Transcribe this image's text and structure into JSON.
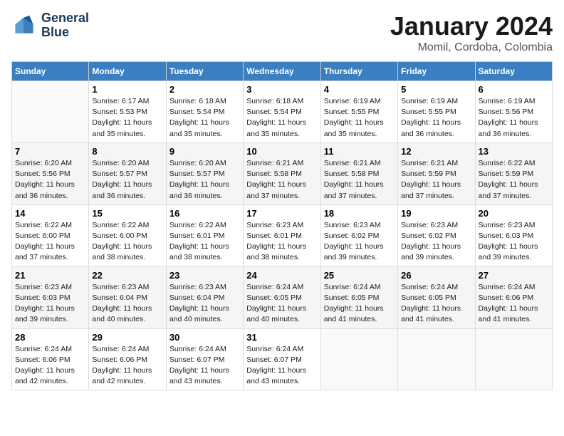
{
  "logo": {
    "line1": "General",
    "line2": "Blue"
  },
  "title": "January 2024",
  "subtitle": "Momil, Cordoba, Colombia",
  "days_header": [
    "Sunday",
    "Monday",
    "Tuesday",
    "Wednesday",
    "Thursday",
    "Friday",
    "Saturday"
  ],
  "weeks": [
    [
      {
        "num": "",
        "info": ""
      },
      {
        "num": "1",
        "info": "Sunrise: 6:17 AM\nSunset: 5:53 PM\nDaylight: 11 hours\nand 35 minutes."
      },
      {
        "num": "2",
        "info": "Sunrise: 6:18 AM\nSunset: 5:54 PM\nDaylight: 11 hours\nand 35 minutes."
      },
      {
        "num": "3",
        "info": "Sunrise: 6:18 AM\nSunset: 5:54 PM\nDaylight: 11 hours\nand 35 minutes."
      },
      {
        "num": "4",
        "info": "Sunrise: 6:19 AM\nSunset: 5:55 PM\nDaylight: 11 hours\nand 35 minutes."
      },
      {
        "num": "5",
        "info": "Sunrise: 6:19 AM\nSunset: 5:55 PM\nDaylight: 11 hours\nand 36 minutes."
      },
      {
        "num": "6",
        "info": "Sunrise: 6:19 AM\nSunset: 5:56 PM\nDaylight: 11 hours\nand 36 minutes."
      }
    ],
    [
      {
        "num": "7",
        "info": "Sunrise: 6:20 AM\nSunset: 5:56 PM\nDaylight: 11 hours\nand 36 minutes."
      },
      {
        "num": "8",
        "info": "Sunrise: 6:20 AM\nSunset: 5:57 PM\nDaylight: 11 hours\nand 36 minutes."
      },
      {
        "num": "9",
        "info": "Sunrise: 6:20 AM\nSunset: 5:57 PM\nDaylight: 11 hours\nand 36 minutes."
      },
      {
        "num": "10",
        "info": "Sunrise: 6:21 AM\nSunset: 5:58 PM\nDaylight: 11 hours\nand 37 minutes."
      },
      {
        "num": "11",
        "info": "Sunrise: 6:21 AM\nSunset: 5:58 PM\nDaylight: 11 hours\nand 37 minutes."
      },
      {
        "num": "12",
        "info": "Sunrise: 6:21 AM\nSunset: 5:59 PM\nDaylight: 11 hours\nand 37 minutes."
      },
      {
        "num": "13",
        "info": "Sunrise: 6:22 AM\nSunset: 5:59 PM\nDaylight: 11 hours\nand 37 minutes."
      }
    ],
    [
      {
        "num": "14",
        "info": "Sunrise: 6:22 AM\nSunset: 6:00 PM\nDaylight: 11 hours\nand 37 minutes."
      },
      {
        "num": "15",
        "info": "Sunrise: 6:22 AM\nSunset: 6:00 PM\nDaylight: 11 hours\nand 38 minutes."
      },
      {
        "num": "16",
        "info": "Sunrise: 6:22 AM\nSunset: 6:01 PM\nDaylight: 11 hours\nand 38 minutes."
      },
      {
        "num": "17",
        "info": "Sunrise: 6:23 AM\nSunset: 6:01 PM\nDaylight: 11 hours\nand 38 minutes."
      },
      {
        "num": "18",
        "info": "Sunrise: 6:23 AM\nSunset: 6:02 PM\nDaylight: 11 hours\nand 39 minutes."
      },
      {
        "num": "19",
        "info": "Sunrise: 6:23 AM\nSunset: 6:02 PM\nDaylight: 11 hours\nand 39 minutes."
      },
      {
        "num": "20",
        "info": "Sunrise: 6:23 AM\nSunset: 6:03 PM\nDaylight: 11 hours\nand 39 minutes."
      }
    ],
    [
      {
        "num": "21",
        "info": "Sunrise: 6:23 AM\nSunset: 6:03 PM\nDaylight: 11 hours\nand 39 minutes."
      },
      {
        "num": "22",
        "info": "Sunrise: 6:23 AM\nSunset: 6:04 PM\nDaylight: 11 hours\nand 40 minutes."
      },
      {
        "num": "23",
        "info": "Sunrise: 6:23 AM\nSunset: 6:04 PM\nDaylight: 11 hours\nand 40 minutes."
      },
      {
        "num": "24",
        "info": "Sunrise: 6:24 AM\nSunset: 6:05 PM\nDaylight: 11 hours\nand 40 minutes."
      },
      {
        "num": "25",
        "info": "Sunrise: 6:24 AM\nSunset: 6:05 PM\nDaylight: 11 hours\nand 41 minutes."
      },
      {
        "num": "26",
        "info": "Sunrise: 6:24 AM\nSunset: 6:05 PM\nDaylight: 11 hours\nand 41 minutes."
      },
      {
        "num": "27",
        "info": "Sunrise: 6:24 AM\nSunset: 6:06 PM\nDaylight: 11 hours\nand 41 minutes."
      }
    ],
    [
      {
        "num": "28",
        "info": "Sunrise: 6:24 AM\nSunset: 6:06 PM\nDaylight: 11 hours\nand 42 minutes."
      },
      {
        "num": "29",
        "info": "Sunrise: 6:24 AM\nSunset: 6:06 PM\nDaylight: 11 hours\nand 42 minutes."
      },
      {
        "num": "30",
        "info": "Sunrise: 6:24 AM\nSunset: 6:07 PM\nDaylight: 11 hours\nand 43 minutes."
      },
      {
        "num": "31",
        "info": "Sunrise: 6:24 AM\nSunset: 6:07 PM\nDaylight: 11 hours\nand 43 minutes."
      },
      {
        "num": "",
        "info": ""
      },
      {
        "num": "",
        "info": ""
      },
      {
        "num": "",
        "info": ""
      }
    ]
  ]
}
